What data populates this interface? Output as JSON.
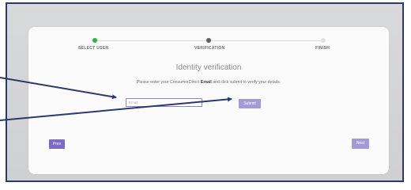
{
  "steps": [
    {
      "label": "SELECT USER",
      "state": "complete"
    },
    {
      "label": "VERIFICATION",
      "state": "current"
    },
    {
      "label": "FINISH",
      "state": "upcoming"
    }
  ],
  "colors": {
    "step_complete": "#2bb53a",
    "step_current": "#5d5d5d",
    "step_upcoming": "#d9d9d9",
    "primary_button": "#7b6bc2",
    "light_button": "#a59ad8",
    "annotation_arrow": "#2b3a6b"
  },
  "main": {
    "title": "Identity verification",
    "instructions_pre": "Please enter your ConsumerDirect ",
    "instructions_bold": "Email",
    "instructions_post": " and click submit to verify your details.",
    "email_placeholder": "Email",
    "submit_label": "Submit"
  },
  "nav": {
    "prev_label": "Prev",
    "next_label": "Next"
  }
}
